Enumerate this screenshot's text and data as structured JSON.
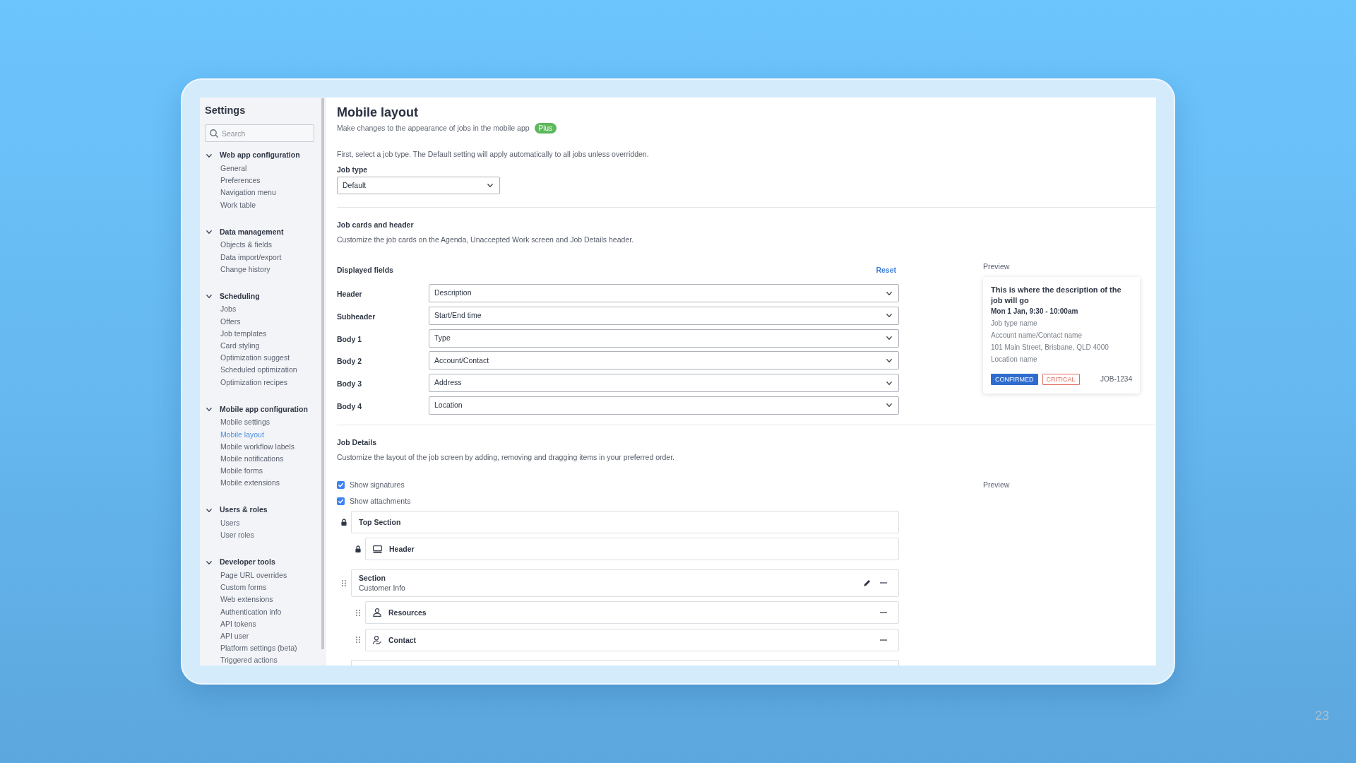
{
  "sidebar": {
    "title": "Settings",
    "search": {
      "placeholder": "Search"
    },
    "groups": [
      {
        "label": "Web app configuration",
        "expanded": true,
        "items": [
          {
            "label": "General",
            "selected": false
          },
          {
            "label": "Preferences",
            "selected": false
          },
          {
            "label": "Navigation menu",
            "selected": false
          },
          {
            "label": "Work table",
            "selected": false
          }
        ]
      },
      {
        "label": "Data management",
        "expanded": true,
        "items": [
          {
            "label": "Objects & fields",
            "selected": false
          },
          {
            "label": "Data import/export",
            "selected": false
          },
          {
            "label": "Change history",
            "selected": false
          }
        ]
      },
      {
        "label": "Scheduling",
        "expanded": true,
        "items": [
          {
            "label": "Jobs",
            "selected": false
          },
          {
            "label": "Offers",
            "selected": false
          },
          {
            "label": "Job templates",
            "selected": false
          },
          {
            "label": "Card styling",
            "selected": false
          },
          {
            "label": "Optimization suggest",
            "selected": false
          },
          {
            "label": "Scheduled optimization",
            "selected": false
          },
          {
            "label": "Optimization recipes",
            "selected": false
          }
        ]
      },
      {
        "label": "Mobile app configuration",
        "expanded": true,
        "items": [
          {
            "label": "Mobile settings",
            "selected": false
          },
          {
            "label": "Mobile layout",
            "selected": true
          },
          {
            "label": "Mobile workflow labels",
            "selected": false
          },
          {
            "label": "Mobile notifications",
            "selected": false
          },
          {
            "label": "Mobile forms",
            "selected": false
          },
          {
            "label": "Mobile extensions",
            "selected": false
          }
        ]
      },
      {
        "label": "Users & roles",
        "expanded": true,
        "items": [
          {
            "label": "Users",
            "selected": false
          },
          {
            "label": "User roles",
            "selected": false
          }
        ]
      },
      {
        "label": "Developer tools",
        "expanded": true,
        "items": [
          {
            "label": "Page URL overrides",
            "selected": false
          },
          {
            "label": "Custom forms",
            "selected": false
          },
          {
            "label": "Web extensions",
            "selected": false
          },
          {
            "label": "Authentication info",
            "selected": false
          },
          {
            "label": "API tokens",
            "selected": false
          },
          {
            "label": "API user",
            "selected": false
          },
          {
            "label": "Platform settings (beta)",
            "selected": false
          },
          {
            "label": "Triggered actions",
            "selected": false
          }
        ]
      }
    ]
  },
  "page": {
    "title": "Mobile layout",
    "subtitle": "Make changes to the appearance of jobs in the mobile app",
    "plan_badge": "Plus",
    "intro": "First, select a job type. The Default setting will apply automatically to all jobs unless overridden.",
    "job_type": {
      "label": "Job type",
      "value": "Default"
    }
  },
  "job_cards": {
    "title": "Job cards and header",
    "description": "Customize the job cards on the Agenda, Unaccepted Work screen and Job Details header.",
    "fields_title": "Displayed fields",
    "reset": "Reset",
    "fields": [
      {
        "label": "Header",
        "value": "Description"
      },
      {
        "label": "Subheader",
        "value": "Start/End time"
      },
      {
        "label": "Body 1",
        "value": "Type"
      },
      {
        "label": "Body 2",
        "value": "Account/Contact"
      },
      {
        "label": "Body 3",
        "value": "Address"
      },
      {
        "label": "Body 4",
        "value": "Location"
      }
    ],
    "preview": {
      "label": "Preview",
      "title": "This is where the description of the job will go",
      "time": "Mon 1 Jan, 9:30 - 10:00am",
      "lines": [
        "Job type name",
        "Account name/Contact name",
        "101 Main Street, Brisbane, QLD 4000",
        "Location name"
      ],
      "badges": [
        {
          "label": "CONFIRMED",
          "kind": "filled",
          "color": "#2f6ccf"
        },
        {
          "label": "CRITICAL",
          "kind": "outline",
          "color": "#e0675c"
        }
      ],
      "job_id": "JOB-1234"
    }
  },
  "job_details": {
    "title": "Job Details",
    "description": "Customize the layout of the job screen by adding, removing and dragging items in your preferred order.",
    "toggles": [
      {
        "label": "Show signatures",
        "checked": true
      },
      {
        "label": "Show attachments",
        "checked": true
      }
    ],
    "preview_label": "Preview",
    "layout": [
      {
        "kind": "section",
        "title": "Top Section",
        "locked": true,
        "editable": false,
        "removable": false,
        "cut_off": false,
        "children": [
          {
            "kind": "header",
            "title": "Header",
            "locked": true,
            "removable": false
          }
        ]
      },
      {
        "kind": "section",
        "title": "Section",
        "subtitle": "Customer Info",
        "locked": false,
        "editable": true,
        "removable": true,
        "cut_off": false,
        "children": [
          {
            "kind": "resources",
            "title": "Resources",
            "locked": false,
            "removable": true
          },
          {
            "kind": "contact",
            "title": "Contact",
            "locked": false,
            "removable": true
          }
        ]
      },
      {
        "kind": "section",
        "cut_off": true
      }
    ]
  },
  "slide_number": "23"
}
